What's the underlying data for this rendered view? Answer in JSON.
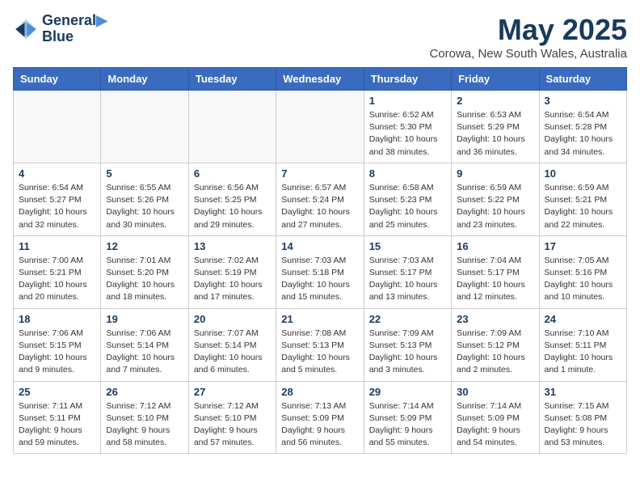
{
  "header": {
    "logo_line1": "General",
    "logo_line2": "Blue",
    "month_title": "May 2025",
    "location": "Corowa, New South Wales, Australia"
  },
  "days_of_week": [
    "Sunday",
    "Monday",
    "Tuesday",
    "Wednesday",
    "Thursday",
    "Friday",
    "Saturday"
  ],
  "weeks": [
    [
      {
        "day": "",
        "info": ""
      },
      {
        "day": "",
        "info": ""
      },
      {
        "day": "",
        "info": ""
      },
      {
        "day": "",
        "info": ""
      },
      {
        "day": "1",
        "info": "Sunrise: 6:52 AM\nSunset: 5:30 PM\nDaylight: 10 hours\nand 38 minutes."
      },
      {
        "day": "2",
        "info": "Sunrise: 6:53 AM\nSunset: 5:29 PM\nDaylight: 10 hours\nand 36 minutes."
      },
      {
        "day": "3",
        "info": "Sunrise: 6:54 AM\nSunset: 5:28 PM\nDaylight: 10 hours\nand 34 minutes."
      }
    ],
    [
      {
        "day": "4",
        "info": "Sunrise: 6:54 AM\nSunset: 5:27 PM\nDaylight: 10 hours\nand 32 minutes."
      },
      {
        "day": "5",
        "info": "Sunrise: 6:55 AM\nSunset: 5:26 PM\nDaylight: 10 hours\nand 30 minutes."
      },
      {
        "day": "6",
        "info": "Sunrise: 6:56 AM\nSunset: 5:25 PM\nDaylight: 10 hours\nand 29 minutes."
      },
      {
        "day": "7",
        "info": "Sunrise: 6:57 AM\nSunset: 5:24 PM\nDaylight: 10 hours\nand 27 minutes."
      },
      {
        "day": "8",
        "info": "Sunrise: 6:58 AM\nSunset: 5:23 PM\nDaylight: 10 hours\nand 25 minutes."
      },
      {
        "day": "9",
        "info": "Sunrise: 6:59 AM\nSunset: 5:22 PM\nDaylight: 10 hours\nand 23 minutes."
      },
      {
        "day": "10",
        "info": "Sunrise: 6:59 AM\nSunset: 5:21 PM\nDaylight: 10 hours\nand 22 minutes."
      }
    ],
    [
      {
        "day": "11",
        "info": "Sunrise: 7:00 AM\nSunset: 5:21 PM\nDaylight: 10 hours\nand 20 minutes."
      },
      {
        "day": "12",
        "info": "Sunrise: 7:01 AM\nSunset: 5:20 PM\nDaylight: 10 hours\nand 18 minutes."
      },
      {
        "day": "13",
        "info": "Sunrise: 7:02 AM\nSunset: 5:19 PM\nDaylight: 10 hours\nand 17 minutes."
      },
      {
        "day": "14",
        "info": "Sunrise: 7:03 AM\nSunset: 5:18 PM\nDaylight: 10 hours\nand 15 minutes."
      },
      {
        "day": "15",
        "info": "Sunrise: 7:03 AM\nSunset: 5:17 PM\nDaylight: 10 hours\nand 13 minutes."
      },
      {
        "day": "16",
        "info": "Sunrise: 7:04 AM\nSunset: 5:17 PM\nDaylight: 10 hours\nand 12 minutes."
      },
      {
        "day": "17",
        "info": "Sunrise: 7:05 AM\nSunset: 5:16 PM\nDaylight: 10 hours\nand 10 minutes."
      }
    ],
    [
      {
        "day": "18",
        "info": "Sunrise: 7:06 AM\nSunset: 5:15 PM\nDaylight: 10 hours\nand 9 minutes."
      },
      {
        "day": "19",
        "info": "Sunrise: 7:06 AM\nSunset: 5:14 PM\nDaylight: 10 hours\nand 7 minutes."
      },
      {
        "day": "20",
        "info": "Sunrise: 7:07 AM\nSunset: 5:14 PM\nDaylight: 10 hours\nand 6 minutes."
      },
      {
        "day": "21",
        "info": "Sunrise: 7:08 AM\nSunset: 5:13 PM\nDaylight: 10 hours\nand 5 minutes."
      },
      {
        "day": "22",
        "info": "Sunrise: 7:09 AM\nSunset: 5:13 PM\nDaylight: 10 hours\nand 3 minutes."
      },
      {
        "day": "23",
        "info": "Sunrise: 7:09 AM\nSunset: 5:12 PM\nDaylight: 10 hours\nand 2 minutes."
      },
      {
        "day": "24",
        "info": "Sunrise: 7:10 AM\nSunset: 5:11 PM\nDaylight: 10 hours\nand 1 minute."
      }
    ],
    [
      {
        "day": "25",
        "info": "Sunrise: 7:11 AM\nSunset: 5:11 PM\nDaylight: 9 hours\nand 59 minutes."
      },
      {
        "day": "26",
        "info": "Sunrise: 7:12 AM\nSunset: 5:10 PM\nDaylight: 9 hours\nand 58 minutes."
      },
      {
        "day": "27",
        "info": "Sunrise: 7:12 AM\nSunset: 5:10 PM\nDaylight: 9 hours\nand 57 minutes."
      },
      {
        "day": "28",
        "info": "Sunrise: 7:13 AM\nSunset: 5:09 PM\nDaylight: 9 hours\nand 56 minutes."
      },
      {
        "day": "29",
        "info": "Sunrise: 7:14 AM\nSunset: 5:09 PM\nDaylight: 9 hours\nand 55 minutes."
      },
      {
        "day": "30",
        "info": "Sunrise: 7:14 AM\nSunset: 5:09 PM\nDaylight: 9 hours\nand 54 minutes."
      },
      {
        "day": "31",
        "info": "Sunrise: 7:15 AM\nSunset: 5:08 PM\nDaylight: 9 hours\nand 53 minutes."
      }
    ]
  ]
}
